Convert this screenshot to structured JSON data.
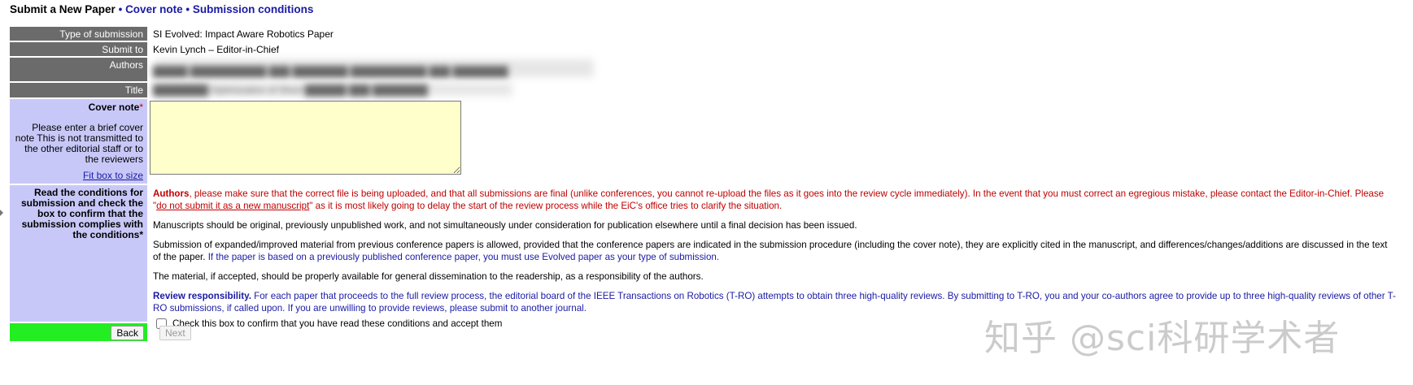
{
  "heading": {
    "current": "Submit a New Paper",
    "separator": "•",
    "steps": [
      "Cover note",
      "Submission conditions"
    ]
  },
  "fields": {
    "type_label": "Type of submission",
    "type_value": "SI Evolved: Impact Aware Robotics Paper",
    "submit_to_label": "Submit to",
    "submit_to_value": "Kevin Lynch – Editor-in-Chief",
    "authors_label": "Authors",
    "authors_value": "█████ ███████████ ███ ████████ ███████████ ███ ████████",
    "title_label": "Title",
    "title_value": "████████ Optimization of Short ██████ ███ ████████"
  },
  "cover": {
    "label": "Cover note",
    "required_mark": "*",
    "help": "Please enter a brief cover note This is not transmitted to the other editorial staff or to the reviewers",
    "fit_link": "Fit box to size",
    "value": ""
  },
  "conditions": {
    "label": "Read the conditions for submission and check the box to confirm that the submission complies with the conditions*",
    "p1_bold": "Authors",
    "p1_text": ", please make sure that the correct file is being uploaded, and that all submissions are final (unlike conferences, you cannot re-upload the files as it goes into the review cycle immediately). In the event that you must correct an egregious mistake, please contact the Editor-in-Chief. Please \"",
    "p1_link": "do not submit it as a new manuscript",
    "p1_tail": "\" as it is most likely going to delay the start of the review process while the EiC's office tries to clarify the situation.",
    "p2": "Manuscripts should be original, previously unpublished work, and not simultaneously under consideration for publication elsewhere until a final decision has been issued.",
    "p3_black": "Submission of expanded/improved material from previous conference papers is allowed, provided that the conference papers are indicated in the submission procedure (including the cover note), they are explicitly cited in the manuscript, and differences/changes/additions are discussed in the text of the paper.",
    "p3_blue": " If the paper is based on a previously published conference paper, you must use Evolved paper as your type of submission.",
    "p4": "The material, if accepted, should be properly available for general dissemination to the readership, as a responsibility of the authors.",
    "p5_bold": "Review responsibility.",
    "p5_text": " For each paper that proceeds to the full review process, the editorial board of the IEEE Transactions on Robotics (T-RO) attempts to obtain three high-quality reviews. By submitting to T-RO, you and your co-authors agree to provide up to three high-quality reviews of other T-RO submissions, if called upon. If you are unwilling to provide reviews, please submit to another journal.",
    "checkbox_label": "Check this box to confirm that you have read these conditions and accept them"
  },
  "nav": {
    "back": "Back",
    "next": "Next"
  },
  "watermark": "知乎 @sci科研学术者",
  "colors": {
    "label_gray": "#6b6b6b",
    "label_purple": "#c8c8f8",
    "nav_green": "#22ee22",
    "textarea_yellow": "#ffffcc",
    "link_blue": "#1a1aa6",
    "warn_red": "#c00000"
  }
}
